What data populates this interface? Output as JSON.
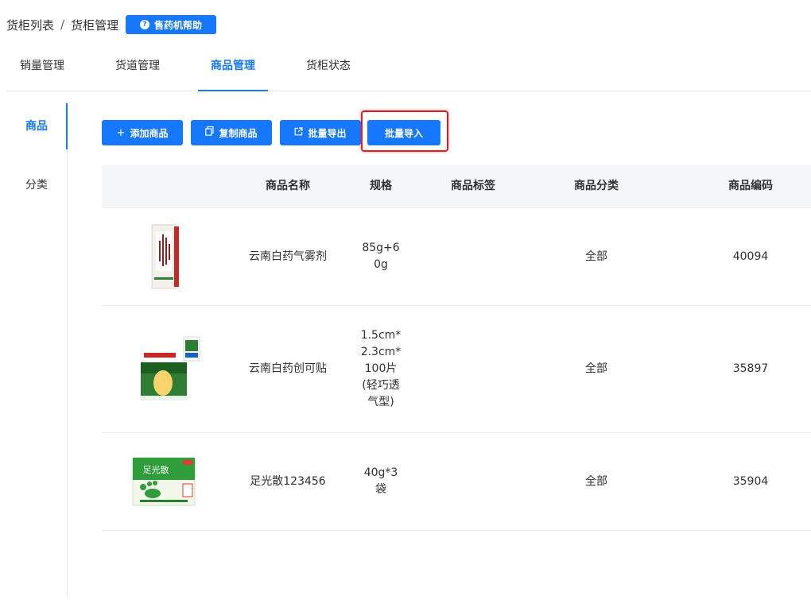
{
  "breadcrumb": {
    "item1": "货柜列表",
    "separator": "/",
    "item2": "货柜管理"
  },
  "help_button": {
    "label": "售药机帮助",
    "icon": "question-circle-icon"
  },
  "tabs": [
    {
      "label": "销量管理"
    },
    {
      "label": "货道管理"
    },
    {
      "label": "商品管理",
      "active": true
    },
    {
      "label": "货柜状态"
    }
  ],
  "sidebar": {
    "items": [
      {
        "label": "商品",
        "active": true
      },
      {
        "label": "分类"
      }
    ]
  },
  "toolbar": {
    "add": {
      "label": "添加商品",
      "icon": "plus-icon"
    },
    "copy": {
      "label": "复制商品",
      "icon": "copy-icon"
    },
    "export": {
      "label": "批量导出",
      "icon": "export-icon"
    },
    "import": {
      "label": "批量导入"
    }
  },
  "table": {
    "columns": [
      "商品名称",
      "规格",
      "商品标签",
      "商品分类",
      "商品编码"
    ],
    "rows": [
      {
        "name": "云南白药气雾剂",
        "spec": "85g+60g",
        "tag": "",
        "category": "全部",
        "code": "40094"
      },
      {
        "name": "云南白药创可贴",
        "spec": "1.5cm*2.3cm*100片(轻巧透气型)",
        "tag": "",
        "category": "全部",
        "code": "35897"
      },
      {
        "name": "足光散123456",
        "spec": "40g*3袋",
        "tag": "",
        "category": "全部",
        "code": "35904"
      }
    ]
  },
  "product_image_text": {
    "box3": "足光散"
  },
  "colors": {
    "primary": "#1677ff",
    "highlight": "#e02020",
    "header_bg": "#f5f6f8"
  }
}
